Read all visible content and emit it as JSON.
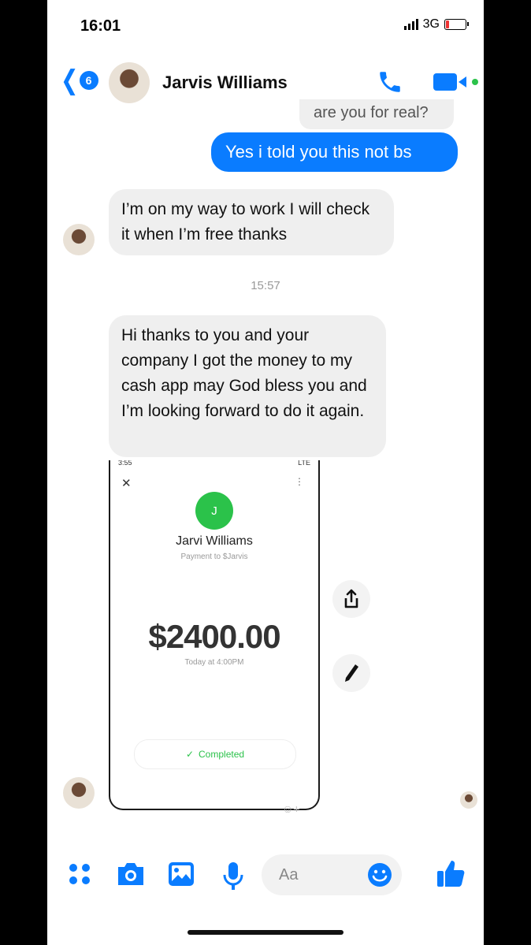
{
  "status_bar": {
    "time": "16:01",
    "network": "3G",
    "battery_level": 0.15
  },
  "header": {
    "back_count": "6",
    "contact_name": "Jarvis Williams"
  },
  "messages": {
    "previous_incoming": "are you for real?",
    "outgoing": "Yes i told you this not bs",
    "incoming_1": "I’m on my way to work I will check it when I’m free thanks",
    "timestamp": "15:57",
    "incoming_2": "Hi thanks to you and your company I got the money to my cash app may God bless you and I’m looking forward to do it again."
  },
  "payment_screenshot": {
    "status_time": "3:55",
    "status_right": "LTE",
    "avatar_letter": "J",
    "name": "Jarvi Williams",
    "subtitle": "Payment to $Jarvis",
    "amount": "$2400.00",
    "date": "Today at 4:00PM",
    "status": "Completed"
  },
  "composer": {
    "placeholder": "Aa"
  },
  "colors": {
    "accent": "#0a7cff",
    "cash_green": "#2bc24a",
    "bubble_in": "#efefef"
  }
}
